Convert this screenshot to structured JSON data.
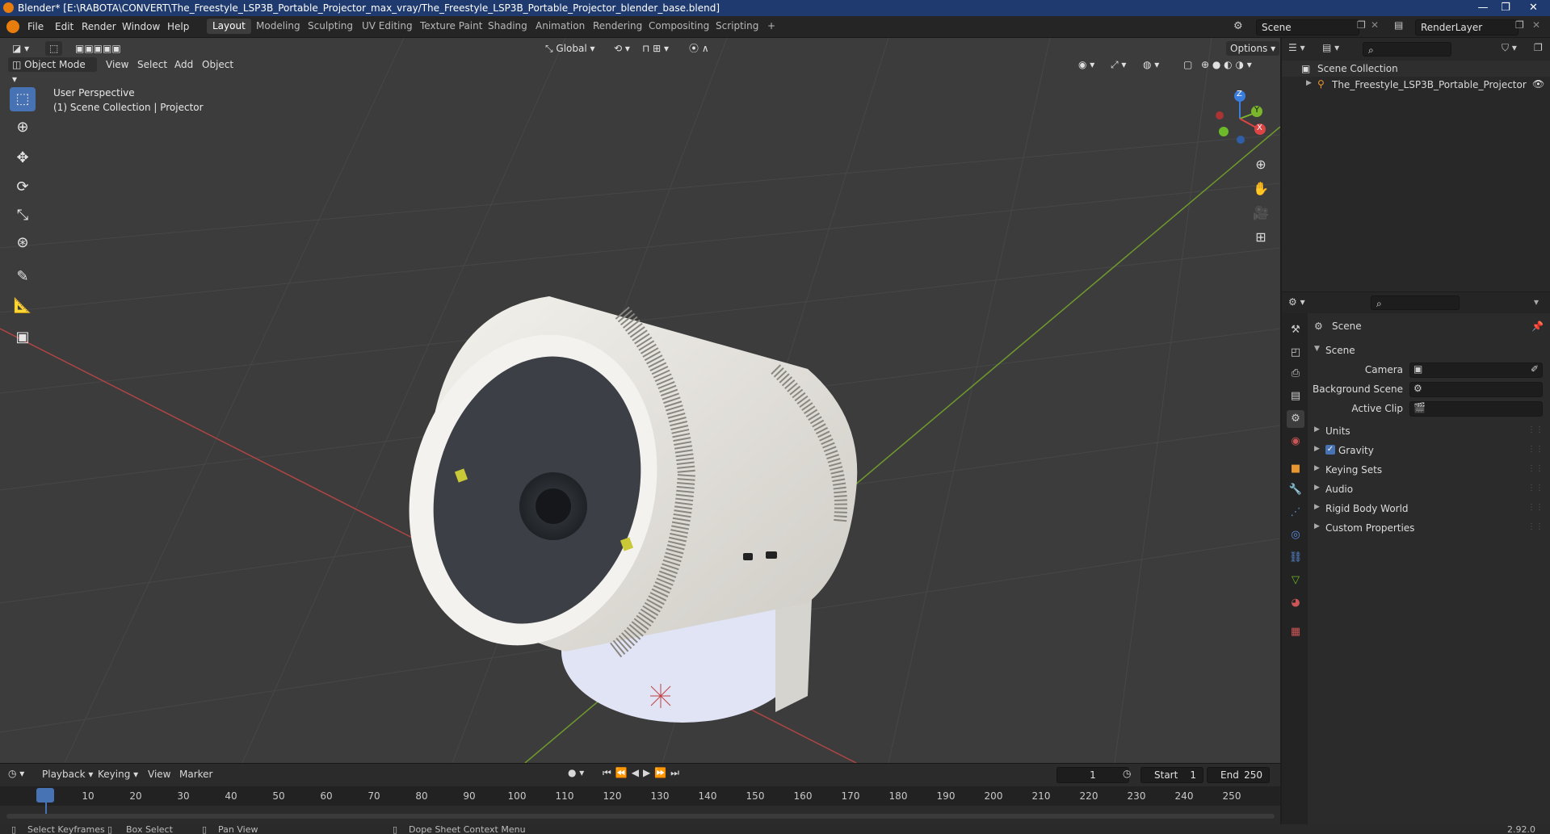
{
  "title_bar": {
    "text": "Blender* [E:\\RABOTA\\CONVERT\\The_Freestyle_LSP3B_Portable_Projector_max_vray/The_Freestyle_LSP3B_Portable_Projector_blender_base.blend]",
    "minimize": "—",
    "maximize": "❐",
    "close": "✕"
  },
  "menu": [
    "File",
    "Edit",
    "Render",
    "Window",
    "Help"
  ],
  "workspaces": [
    "Layout",
    "Modeling",
    "Sculpting",
    "UV Editing",
    "Texture Paint",
    "Shading",
    "Animation",
    "Rendering",
    "Compositing",
    "Scripting"
  ],
  "workspace_add": "+",
  "scene_field": "Scene",
  "view_layer_field": "RenderLayer",
  "viewport": {
    "mode": "Object Mode",
    "menus": [
      "View",
      "Select",
      "Add",
      "Object"
    ],
    "transform_orientation": "Global",
    "options": "Options",
    "overlay_line1": "User Perspective",
    "overlay_line2": "(1) Scene Collection | Projector",
    "gizmo_axes": {
      "x": "X",
      "y": "Y",
      "z": "Z"
    }
  },
  "outliner": {
    "root": "Scene Collection",
    "items": [
      "The_Freestyle_LSP3B_Portable_Projector"
    ]
  },
  "properties": {
    "header": "Scene",
    "section": "Scene",
    "rows": [
      {
        "label": "Camera"
      },
      {
        "label": "Background Scene"
      },
      {
        "label": "Active Clip"
      }
    ],
    "panels": [
      "Units",
      "Gravity",
      "Keying Sets",
      "Audio",
      "Rigid Body World",
      "Custom Properties"
    ],
    "gravity_checked": true
  },
  "timeline": {
    "menus": [
      "Playback",
      "Keying",
      "View",
      "Marker"
    ],
    "current_frame": "1",
    "start_label": "Start",
    "start_value": "1",
    "end_label": "End",
    "end_value": "250",
    "ticks": [
      "1",
      "10",
      "20",
      "30",
      "40",
      "50",
      "60",
      "70",
      "80",
      "90",
      "100",
      "110",
      "120",
      "130",
      "140",
      "150",
      "160",
      "170",
      "180",
      "190",
      "200",
      "210",
      "220",
      "230",
      "240",
      "250"
    ]
  },
  "status_bar": {
    "items": [
      "Select Keyframes",
      "Box Select",
      "Pan View",
      "Dope Sheet Context Menu"
    ],
    "version": "2.92.0"
  },
  "colors": {
    "accent": "#4772b3",
    "viewport_bg": "#3c3c3c",
    "grid_line": "#474747",
    "x_axis": "#b04545",
    "y_axis": "#6e9a2c"
  }
}
